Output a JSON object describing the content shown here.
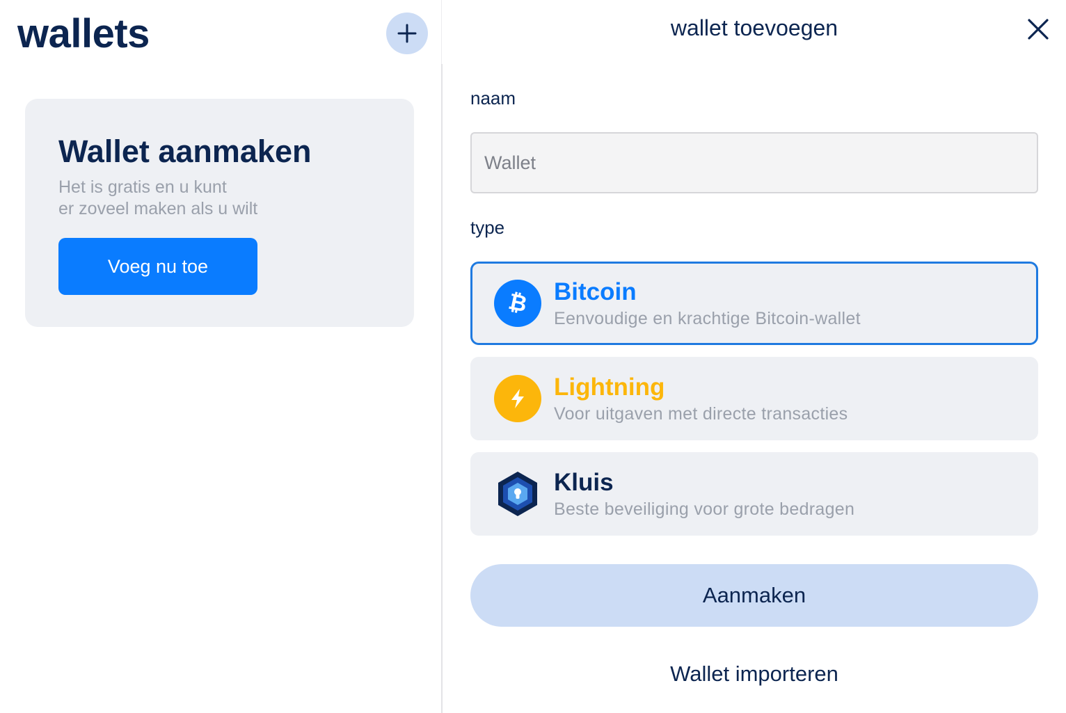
{
  "left": {
    "title": "wallets",
    "add_icon": "plus-icon",
    "card": {
      "title": "Wallet aanmaken",
      "subtitle_line1": "Het is gratis en u kunt",
      "subtitle_line2": "er zoveel maken als u wilt",
      "button_label": "Voeg nu toe"
    }
  },
  "sheet": {
    "title": "wallet toevoegen",
    "close_icon": "close-icon",
    "name_label": "naam",
    "name_placeholder": "Wallet",
    "name_value": "",
    "type_label": "type",
    "types": [
      {
        "name": "Bitcoin",
        "description": "Eenvoudige en krachtige Bitcoin-wallet",
        "icon": "bitcoin-icon",
        "color": "#0a7cff",
        "selected": true
      },
      {
        "name": "Lightning",
        "description": "Voor uitgaven met directe transacties",
        "icon": "lightning-icon",
        "color": "#fcb60b",
        "selected": false
      },
      {
        "name": "Kluis",
        "description": "Beste beveiliging voor grote bedragen",
        "icon": "vault-icon",
        "color": "#0c2550",
        "selected": false
      }
    ],
    "create_button": "Aanmaken",
    "import_link": "Wallet importeren"
  },
  "colors": {
    "accent": "#0a7cff",
    "navy": "#0c2550",
    "light_blue": "#ccdcf5",
    "card_bg": "#eef0f4",
    "lightning": "#fcb60b"
  }
}
